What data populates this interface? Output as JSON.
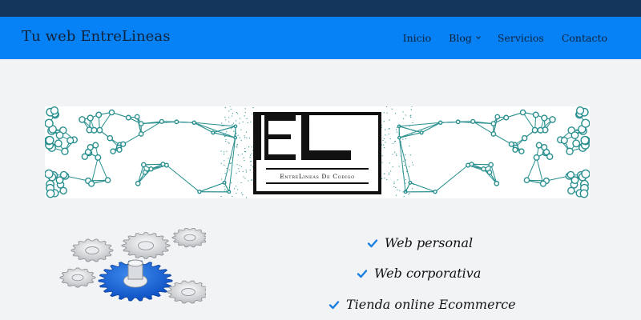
{
  "header": {
    "brand": "Tu web EntreLineas",
    "menu": [
      {
        "label": "Inicio"
      },
      {
        "label": "Blog",
        "has_dropdown": true
      },
      {
        "label": "Servicios"
      },
      {
        "label": "Contacto"
      }
    ]
  },
  "banner": {
    "logo_letters": "EL",
    "logo_caption": "EntreLineas De Codigo"
  },
  "services": {
    "items": [
      {
        "label": "Web personal"
      },
      {
        "label": "Web corporativa"
      },
      {
        "label": "Tienda online Ecommerce"
      }
    ],
    "check_icon": "check-icon",
    "check_color": "#1a7fe0"
  },
  "colors": {
    "topbar": "#15365c",
    "navbar": "#0682f6",
    "background": "#f2f3f5",
    "network": "#2a8f8f",
    "gear_blue": "#1f6fe0"
  }
}
